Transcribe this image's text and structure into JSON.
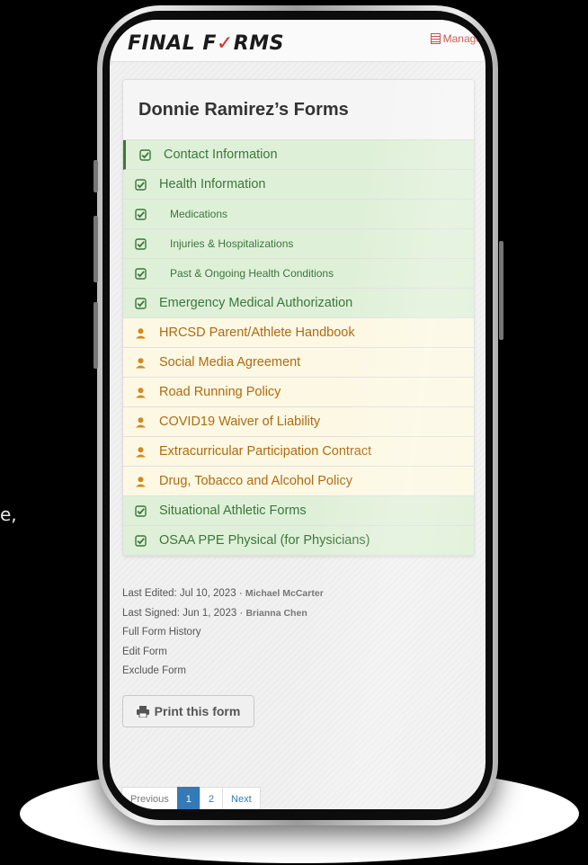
{
  "side_text": "e,",
  "header": {
    "logo_part1": "FINAL F",
    "logo_part2": "✓",
    "logo_part3": "RMS",
    "manage_label": "Manage"
  },
  "card": {
    "title": "Donnie Ramirez’s Forms",
    "rows": [
      {
        "label": "Contact Information",
        "status": "complete",
        "sub": false,
        "active": true
      },
      {
        "label": "Health Information",
        "status": "complete",
        "sub": false,
        "active": false
      },
      {
        "label": "Medications",
        "status": "complete",
        "sub": true,
        "active": false
      },
      {
        "label": "Injuries & Hospitalizations",
        "status": "complete",
        "sub": true,
        "active": false
      },
      {
        "label": "Past & Ongoing Health Conditions",
        "status": "complete",
        "sub": true,
        "active": false
      },
      {
        "label": "Emergency Medical Authorization",
        "status": "complete",
        "sub": false,
        "active": false
      },
      {
        "label": "HRCSD Parent/Athlete Handbook",
        "status": "pending",
        "sub": false,
        "active": false
      },
      {
        "label": "Social Media Agreement",
        "status": "pending",
        "sub": false,
        "active": false
      },
      {
        "label": "Road Running Policy",
        "status": "pending",
        "sub": false,
        "active": false
      },
      {
        "label": "COVID19 Waiver of Liability",
        "status": "pending",
        "sub": false,
        "active": false
      },
      {
        "label": "Extracurricular Participation Contract",
        "status": "pending",
        "sub": false,
        "active": false
      },
      {
        "label": "Drug, Tobacco and Alcohol Policy",
        "status": "pending",
        "sub": false,
        "active": false
      },
      {
        "label": "Situational Athletic Forms",
        "status": "complete",
        "sub": false,
        "active": false
      },
      {
        "label": "OSAA PPE Physical (for Physicians)",
        "status": "complete",
        "sub": false,
        "active": false
      }
    ]
  },
  "meta": {
    "last_edited_label": "Last Edited: Jul 10, 2023 ·",
    "last_edited_by": "Michael McCarter",
    "last_signed_label": "Last Signed: Jun 1, 2023 ·",
    "last_signed_by": "Brianna Chen",
    "history_link": "Full Form History",
    "edit_link": "Edit Form",
    "exclude_link": "Exclude Form"
  },
  "print_button": "Print this form",
  "pagination": {
    "prev": "Previous",
    "pages": [
      "1",
      "2"
    ],
    "current": "1",
    "next": "Next"
  },
  "colors": {
    "complete_bg": "#dff0d8",
    "complete_text": "#3c763d",
    "pending_bg": "#fcf8e3",
    "pending_text": "#b06a12",
    "brand_red": "#d42a2a",
    "link_blue": "#337ab7"
  }
}
